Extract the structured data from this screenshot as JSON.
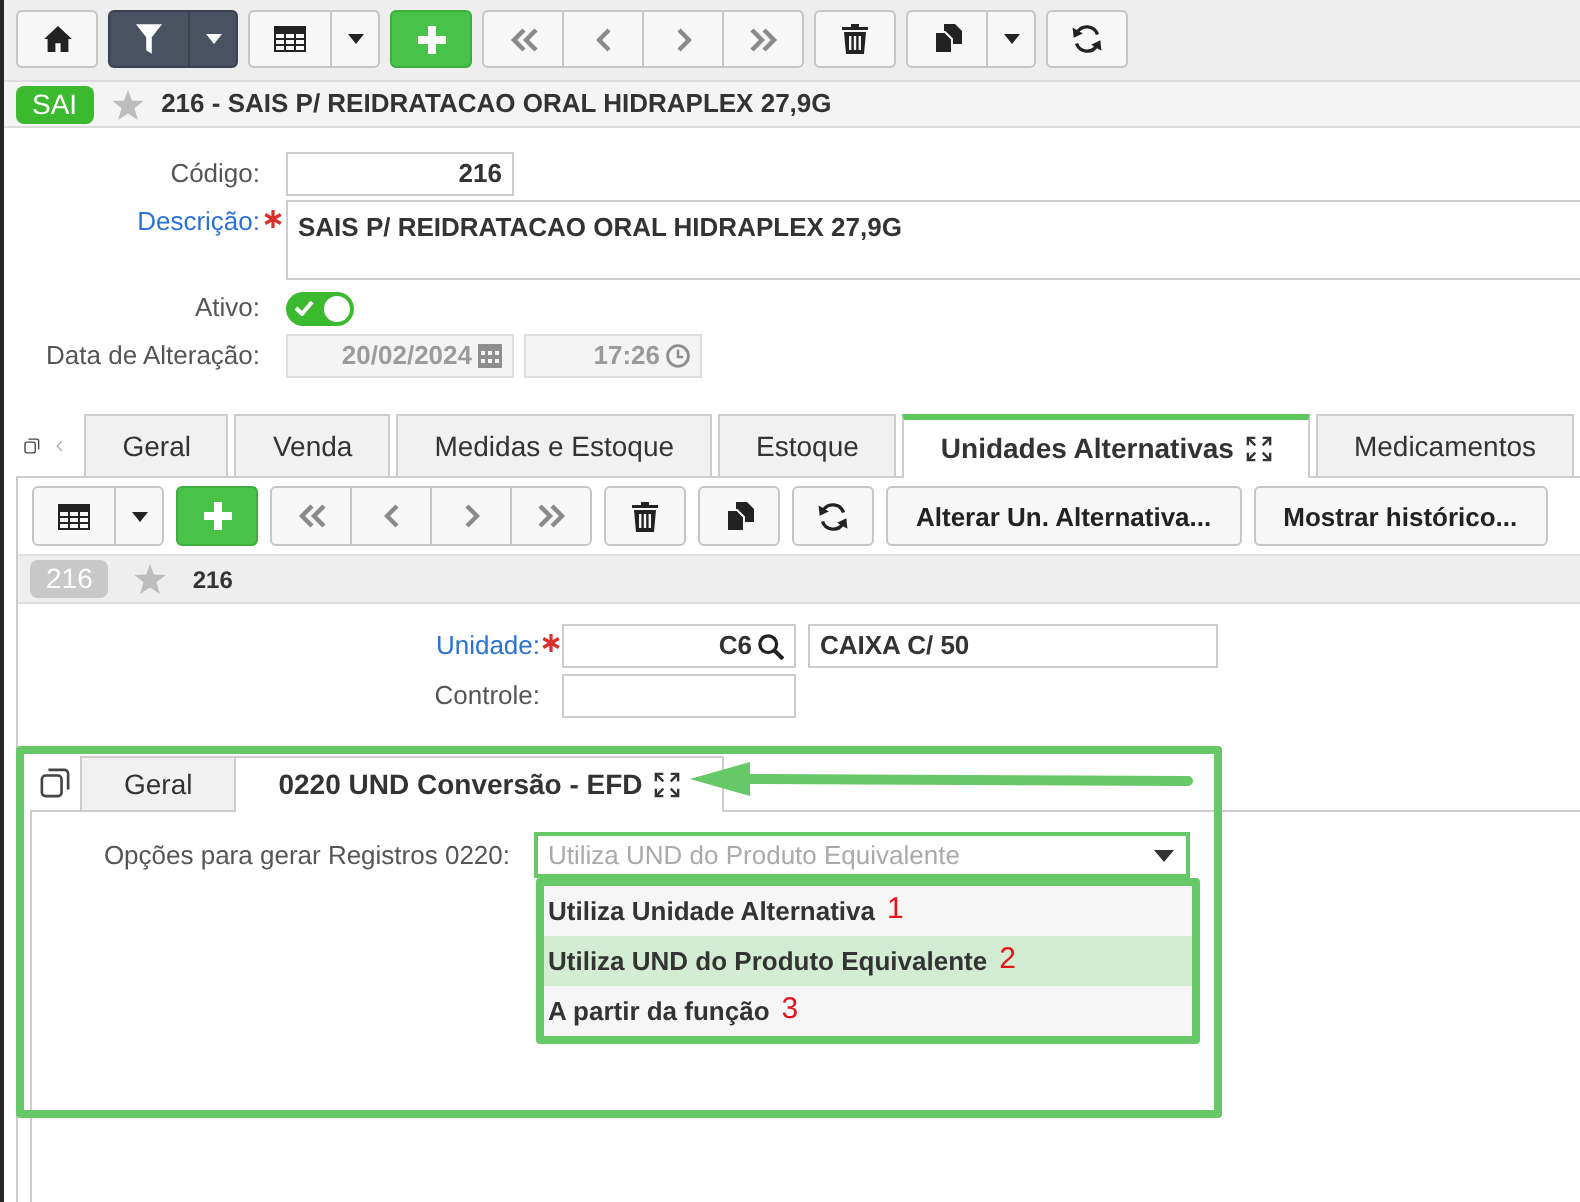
{
  "toolbar": {
    "filter_active": true
  },
  "record_header": {
    "badge": "SAI",
    "favorite": false,
    "title": "216 - SAIS P/ REIDRATACAO ORAL HIDRAPLEX 27,9G"
  },
  "form": {
    "codigo": {
      "label": "Código:",
      "required": false,
      "value": "216"
    },
    "descricao": {
      "label": "Descrição:",
      "required": true,
      "value": "SAIS P/ REIDRATACAO ORAL HIDRAPLEX 27,9G"
    },
    "ativo": {
      "label": "Ativo:",
      "on": true
    },
    "data_alteracao": {
      "label": "Data de Alteração:",
      "disabled": true,
      "date": "20/02/2024",
      "time": "17:26"
    }
  },
  "tabs": [
    {
      "label": "Geral",
      "selected": false
    },
    {
      "label": "Venda",
      "selected": false
    },
    {
      "label": "Medidas e Estoque",
      "selected": false
    },
    {
      "label": "Estoque",
      "selected": false
    },
    {
      "label": "Unidades Alternativas",
      "selected": true
    },
    {
      "label": "Medicamentos",
      "selected": false
    }
  ],
  "tab_panel": {
    "toolbar_buttons": [
      "Alterar Un. Alternativa...",
      "Mostrar histórico..."
    ],
    "record_header": {
      "badge": "216",
      "favorite": false,
      "title": "216"
    },
    "fields": [
      {
        "kind": "lookup",
        "label": "Unidade:",
        "required": true,
        "code": "C6",
        "description": "CAIXA C/ 50"
      },
      {
        "kind": "text",
        "label": "Controle:",
        "required": false
      }
    ],
    "subform": {
      "highlighted": true,
      "arrow": true,
      "tabs": [
        {
          "label": "Geral",
          "selected": false
        },
        {
          "label": "0220 UND Conversão - EFD",
          "selected": true
        }
      ],
      "option_field": {
        "label": "Opções para gerar Registros 0220:",
        "value": "Utiliza UND do Produto Equivalente",
        "expanded": true,
        "options": [
          {
            "label": "Utiliza Unidade Alternativa",
            "annotation": "1",
            "selected": false
          },
          {
            "label": "Utiliza UND do Produto Equivalente",
            "annotation": "2",
            "selected": true
          },
          {
            "label": "A partir da função",
            "annotation": "3",
            "selected": false
          }
        ]
      }
    }
  }
}
